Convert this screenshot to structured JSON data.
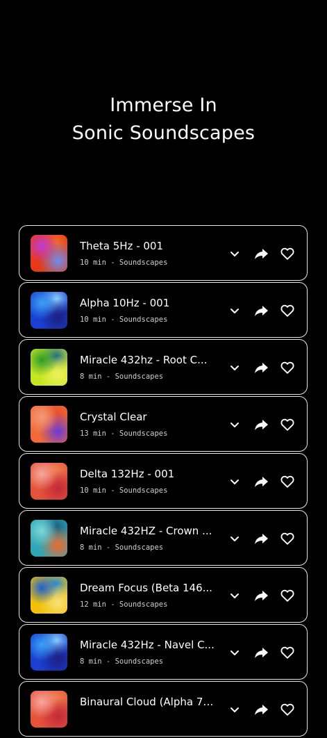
{
  "hero": {
    "line1": "Immerse In",
    "line2": "Sonic Soundscapes"
  },
  "tracks": [
    {
      "title": "Theta 5Hz - 001",
      "meta": "10 min - Soundscapes",
      "colors": [
        "#e43a1a",
        "#c13bd6",
        "#6f8ef0",
        "#f06a2a"
      ]
    },
    {
      "title": "Alpha 10Hz - 001",
      "meta": "10 min - Soundscapes",
      "colors": [
        "#1a3fd1",
        "#3aa2f4",
        "#1c1f80",
        "#8fd2ff"
      ]
    },
    {
      "title": "Miracle 432hz  - Root C...",
      "meta": "8 min - Soundscapes",
      "colors": [
        "#c6e625",
        "#2e9b2a",
        "#f1f05b",
        "#1d6a8f"
      ]
    },
    {
      "title": "Crystal Clear",
      "meta": "13 min - Soundscapes",
      "colors": [
        "#f06a3a",
        "#f49a7a",
        "#6a3ad6",
        "#e8502a"
      ]
    },
    {
      "title": "Delta 132Hz - 001",
      "meta": "10 min - Soundscapes",
      "colors": [
        "#e4533a",
        "#f7a9a0",
        "#c22a3a",
        "#f08050"
      ]
    },
    {
      "title": "Miracle 432HZ - Crown ...",
      "meta": "8 min - Soundscapes",
      "colors": [
        "#2fa6b6",
        "#7fd6d6",
        "#f06a2a",
        "#1c5f7f"
      ]
    },
    {
      "title": "Dream Focus (Beta 146...",
      "meta": "12 min - Soundscapes",
      "colors": [
        "#f2c20a",
        "#1a5fd1",
        "#f7e07a",
        "#2a8ad6"
      ]
    },
    {
      "title": "Miracle 432Hz - Navel C...",
      "meta": "8 min - Soundscapes",
      "colors": [
        "#1a3fd1",
        "#3aa2f4",
        "#1c1f80",
        "#8fd2ff"
      ]
    },
    {
      "title": "Binaural Cloud (Alpha 7 ...",
      "meta": "",
      "colors": [
        "#e4533a",
        "#f7a9a0",
        "#c22a3a",
        "#f08050"
      ]
    }
  ]
}
